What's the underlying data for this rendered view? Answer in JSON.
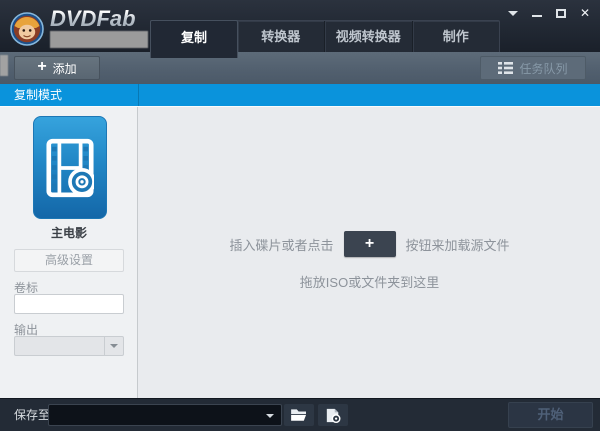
{
  "window": {
    "brand": "DVDFab",
    "controls": {
      "close_glyph": "✕"
    }
  },
  "tabs": [
    {
      "label": "复制",
      "active": true
    },
    {
      "label": "转换器",
      "active": false
    },
    {
      "label": "视频转换器",
      "active": false
    },
    {
      "label": "制作",
      "active": false
    }
  ],
  "toolbar": {
    "plus": "+",
    "add_label": "添加",
    "queue_label": "任务队列"
  },
  "mode_header": {
    "label": "复制模式"
  },
  "sidebar": {
    "tile_label": "主电影",
    "advanced_button": "高级设置",
    "volume_label": "卷标",
    "volume_value": "",
    "output_label": "输出"
  },
  "main": {
    "hint_prefix": "插入碟片或者点击",
    "hint_plus": "+",
    "hint_suffix": "按钮来加载源文件",
    "hint_drop": "拖放ISO或文件夹到这里"
  },
  "bottom": {
    "save_label": "保存至:",
    "save_value": "",
    "start_label": "开始"
  },
  "colors": {
    "accent_blue": "#0a93dc",
    "tile_blue_top": "#36a3dd",
    "tile_blue_bottom": "#1467a8",
    "dark_bar": "#232b36"
  }
}
